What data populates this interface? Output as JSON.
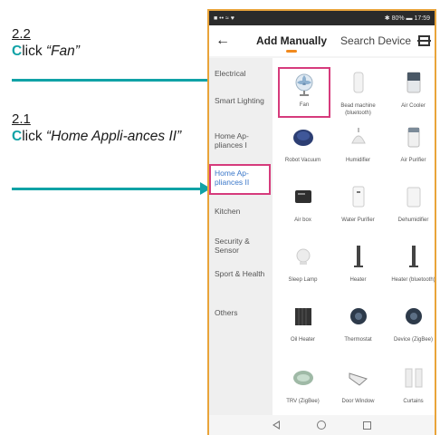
{
  "instructions": {
    "step_a": {
      "number": "2.2",
      "lead": "C",
      "rest": "lick ",
      "target": "“Fan”"
    },
    "step_b": {
      "number": "2.1",
      "lead": "C",
      "rest": "lick ",
      "target": "“Home Appli-ances II”"
    },
    "accent_color": "#10a2a6"
  },
  "status_bar": {
    "left": "■ •• ≈ ♥",
    "right": "✱ 80% ▬ 17:59"
  },
  "header": {
    "back_icon": "←",
    "tabs": [
      "Add Manually",
      "Search Device"
    ],
    "active_tab": "Add Manually",
    "scan_icon": "scan-icon"
  },
  "categories": [
    {
      "label": "Electrical"
    },
    {
      "label": "Smart Lighting"
    },
    {
      "label": "Home Ap-pliances I"
    },
    {
      "label": "Home Ap-pliances II",
      "selected": true
    },
    {
      "label": "Kitchen"
    },
    {
      "label": "Security & Sensor"
    },
    {
      "label": "Sport & Health"
    },
    {
      "label": "Others"
    }
  ],
  "devices": [
    {
      "label": "Fan",
      "icon": "fan-icon",
      "highlighted": true
    },
    {
      "label": "Bead machine (bluetooth)",
      "icon": "bead-machine-icon"
    },
    {
      "label": "Air Cooler",
      "icon": "air-cooler-icon"
    },
    {
      "label": "Robot Vacuum",
      "icon": "robot-vacuum-icon"
    },
    {
      "label": "Humidifier",
      "icon": "humidifier-icon"
    },
    {
      "label": "Air Purifier",
      "icon": "air-purifier-icon"
    },
    {
      "label": "Air box",
      "icon": "air-box-icon"
    },
    {
      "label": "Water Purifier",
      "icon": "water-purifier-icon"
    },
    {
      "label": "Dehumidifier",
      "icon": "dehumidifier-icon"
    },
    {
      "label": "Sleep Lamp",
      "icon": "sleep-lamp-icon"
    },
    {
      "label": "Heater",
      "icon": "heater-icon"
    },
    {
      "label": "Heater (bluetooth)",
      "icon": "heater-bt-icon"
    },
    {
      "label": "Oil Heater",
      "icon": "oil-heater-icon"
    },
    {
      "label": "Thermostat",
      "icon": "thermostat-icon"
    },
    {
      "label": "Device (ZigBee)",
      "icon": "device-zigbee-icon"
    },
    {
      "label": "TRV (ZigBee)",
      "icon": "trv-icon"
    },
    {
      "label": "Door Window",
      "icon": "door-window-icon"
    },
    {
      "label": "Curtains",
      "icon": "curtains-icon"
    }
  ],
  "nav_bar": {
    "back": "back-icon",
    "home": "home-icon",
    "recent": "recent-apps-icon"
  }
}
